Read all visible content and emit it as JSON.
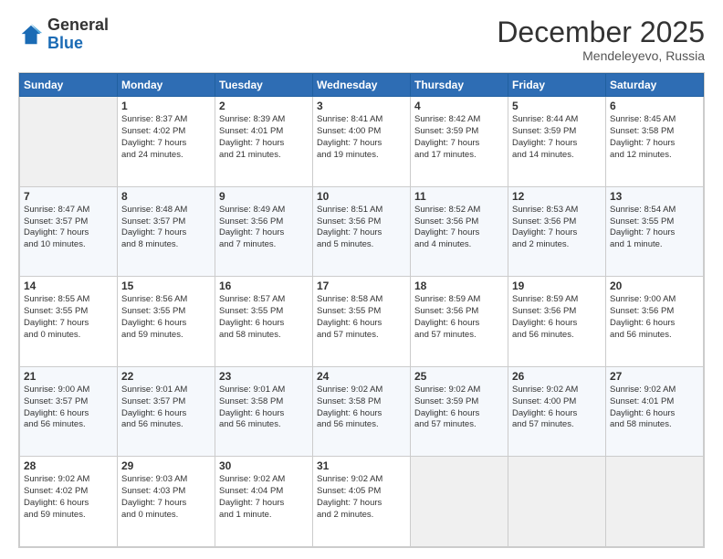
{
  "logo": {
    "general": "General",
    "blue": "Blue"
  },
  "header": {
    "month": "December 2025",
    "location": "Mendeleyevo, Russia"
  },
  "weekdays": [
    "Sunday",
    "Monday",
    "Tuesday",
    "Wednesday",
    "Thursday",
    "Friday",
    "Saturday"
  ],
  "weeks": [
    [
      {
        "day": "",
        "info": ""
      },
      {
        "day": "1",
        "info": "Sunrise: 8:37 AM\nSunset: 4:02 PM\nDaylight: 7 hours\nand 24 minutes."
      },
      {
        "day": "2",
        "info": "Sunrise: 8:39 AM\nSunset: 4:01 PM\nDaylight: 7 hours\nand 21 minutes."
      },
      {
        "day": "3",
        "info": "Sunrise: 8:41 AM\nSunset: 4:00 PM\nDaylight: 7 hours\nand 19 minutes."
      },
      {
        "day": "4",
        "info": "Sunrise: 8:42 AM\nSunset: 3:59 PM\nDaylight: 7 hours\nand 17 minutes."
      },
      {
        "day": "5",
        "info": "Sunrise: 8:44 AM\nSunset: 3:59 PM\nDaylight: 7 hours\nand 14 minutes."
      },
      {
        "day": "6",
        "info": "Sunrise: 8:45 AM\nSunset: 3:58 PM\nDaylight: 7 hours\nand 12 minutes."
      }
    ],
    [
      {
        "day": "7",
        "info": "Sunrise: 8:47 AM\nSunset: 3:57 PM\nDaylight: 7 hours\nand 10 minutes."
      },
      {
        "day": "8",
        "info": "Sunrise: 8:48 AM\nSunset: 3:57 PM\nDaylight: 7 hours\nand 8 minutes."
      },
      {
        "day": "9",
        "info": "Sunrise: 8:49 AM\nSunset: 3:56 PM\nDaylight: 7 hours\nand 7 minutes."
      },
      {
        "day": "10",
        "info": "Sunrise: 8:51 AM\nSunset: 3:56 PM\nDaylight: 7 hours\nand 5 minutes."
      },
      {
        "day": "11",
        "info": "Sunrise: 8:52 AM\nSunset: 3:56 PM\nDaylight: 7 hours\nand 4 minutes."
      },
      {
        "day": "12",
        "info": "Sunrise: 8:53 AM\nSunset: 3:56 PM\nDaylight: 7 hours\nand 2 minutes."
      },
      {
        "day": "13",
        "info": "Sunrise: 8:54 AM\nSunset: 3:55 PM\nDaylight: 7 hours\nand 1 minute."
      }
    ],
    [
      {
        "day": "14",
        "info": "Sunrise: 8:55 AM\nSunset: 3:55 PM\nDaylight: 7 hours\nand 0 minutes."
      },
      {
        "day": "15",
        "info": "Sunrise: 8:56 AM\nSunset: 3:55 PM\nDaylight: 6 hours\nand 59 minutes."
      },
      {
        "day": "16",
        "info": "Sunrise: 8:57 AM\nSunset: 3:55 PM\nDaylight: 6 hours\nand 58 minutes."
      },
      {
        "day": "17",
        "info": "Sunrise: 8:58 AM\nSunset: 3:55 PM\nDaylight: 6 hours\nand 57 minutes."
      },
      {
        "day": "18",
        "info": "Sunrise: 8:59 AM\nSunset: 3:56 PM\nDaylight: 6 hours\nand 57 minutes."
      },
      {
        "day": "19",
        "info": "Sunrise: 8:59 AM\nSunset: 3:56 PM\nDaylight: 6 hours\nand 56 minutes."
      },
      {
        "day": "20",
        "info": "Sunrise: 9:00 AM\nSunset: 3:56 PM\nDaylight: 6 hours\nand 56 minutes."
      }
    ],
    [
      {
        "day": "21",
        "info": "Sunrise: 9:00 AM\nSunset: 3:57 PM\nDaylight: 6 hours\nand 56 minutes."
      },
      {
        "day": "22",
        "info": "Sunrise: 9:01 AM\nSunset: 3:57 PM\nDaylight: 6 hours\nand 56 minutes."
      },
      {
        "day": "23",
        "info": "Sunrise: 9:01 AM\nSunset: 3:58 PM\nDaylight: 6 hours\nand 56 minutes."
      },
      {
        "day": "24",
        "info": "Sunrise: 9:02 AM\nSunset: 3:58 PM\nDaylight: 6 hours\nand 56 minutes."
      },
      {
        "day": "25",
        "info": "Sunrise: 9:02 AM\nSunset: 3:59 PM\nDaylight: 6 hours\nand 57 minutes."
      },
      {
        "day": "26",
        "info": "Sunrise: 9:02 AM\nSunset: 4:00 PM\nDaylight: 6 hours\nand 57 minutes."
      },
      {
        "day": "27",
        "info": "Sunrise: 9:02 AM\nSunset: 4:01 PM\nDaylight: 6 hours\nand 58 minutes."
      }
    ],
    [
      {
        "day": "28",
        "info": "Sunrise: 9:02 AM\nSunset: 4:02 PM\nDaylight: 6 hours\nand 59 minutes."
      },
      {
        "day": "29",
        "info": "Sunrise: 9:03 AM\nSunset: 4:03 PM\nDaylight: 7 hours\nand 0 minutes."
      },
      {
        "day": "30",
        "info": "Sunrise: 9:02 AM\nSunset: 4:04 PM\nDaylight: 7 hours\nand 1 minute."
      },
      {
        "day": "31",
        "info": "Sunrise: 9:02 AM\nSunset: 4:05 PM\nDaylight: 7 hours\nand 2 minutes."
      },
      {
        "day": "",
        "info": ""
      },
      {
        "day": "",
        "info": ""
      },
      {
        "day": "",
        "info": ""
      }
    ]
  ]
}
